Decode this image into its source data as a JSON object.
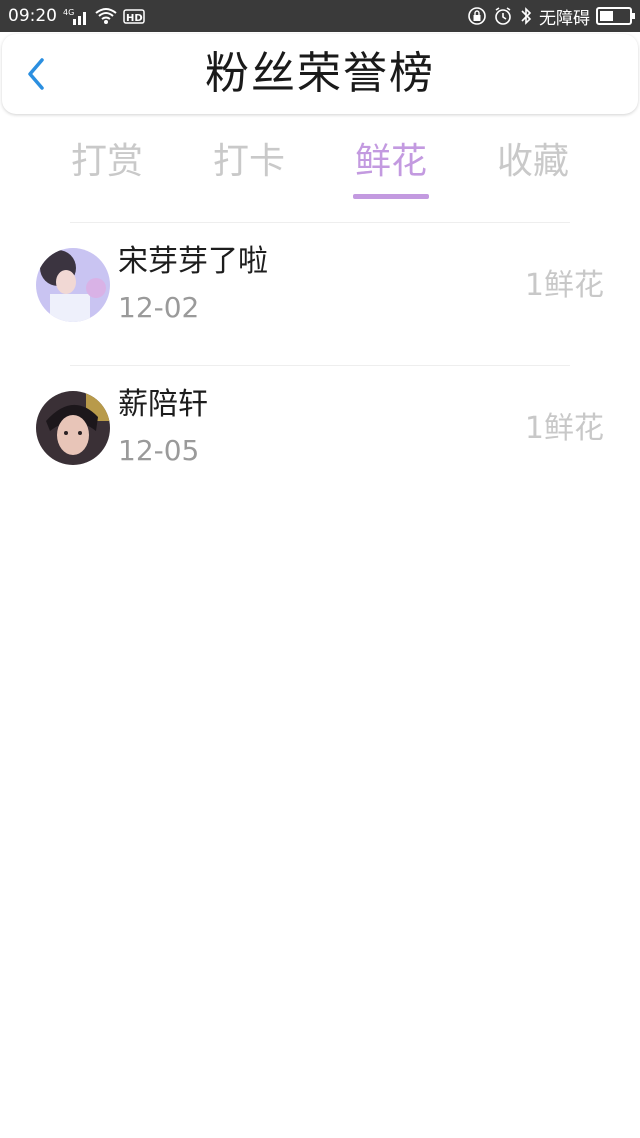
{
  "status_bar": {
    "time": "09:20",
    "network": "4G",
    "hd": "HD",
    "accessibility_label": "无障碍",
    "battery_level": 0.45
  },
  "header": {
    "title": "粉丝荣誉榜",
    "back_icon": "chevron-left-icon"
  },
  "tabs": [
    {
      "label": "打赏",
      "active": false
    },
    {
      "label": "打卡",
      "active": false
    },
    {
      "label": "鲜花",
      "active": true
    },
    {
      "label": "收藏",
      "active": false
    }
  ],
  "colors": {
    "accent": "#c39ae0",
    "back_icon": "#2b8fe0",
    "status_bar": "#3a3a3a"
  },
  "list": [
    {
      "name": "宋芽芽了啦",
      "date": "12-02",
      "amount": "1鲜花"
    },
    {
      "name": "薪陪轩",
      "date": "12-05",
      "amount": "1鲜花"
    }
  ]
}
